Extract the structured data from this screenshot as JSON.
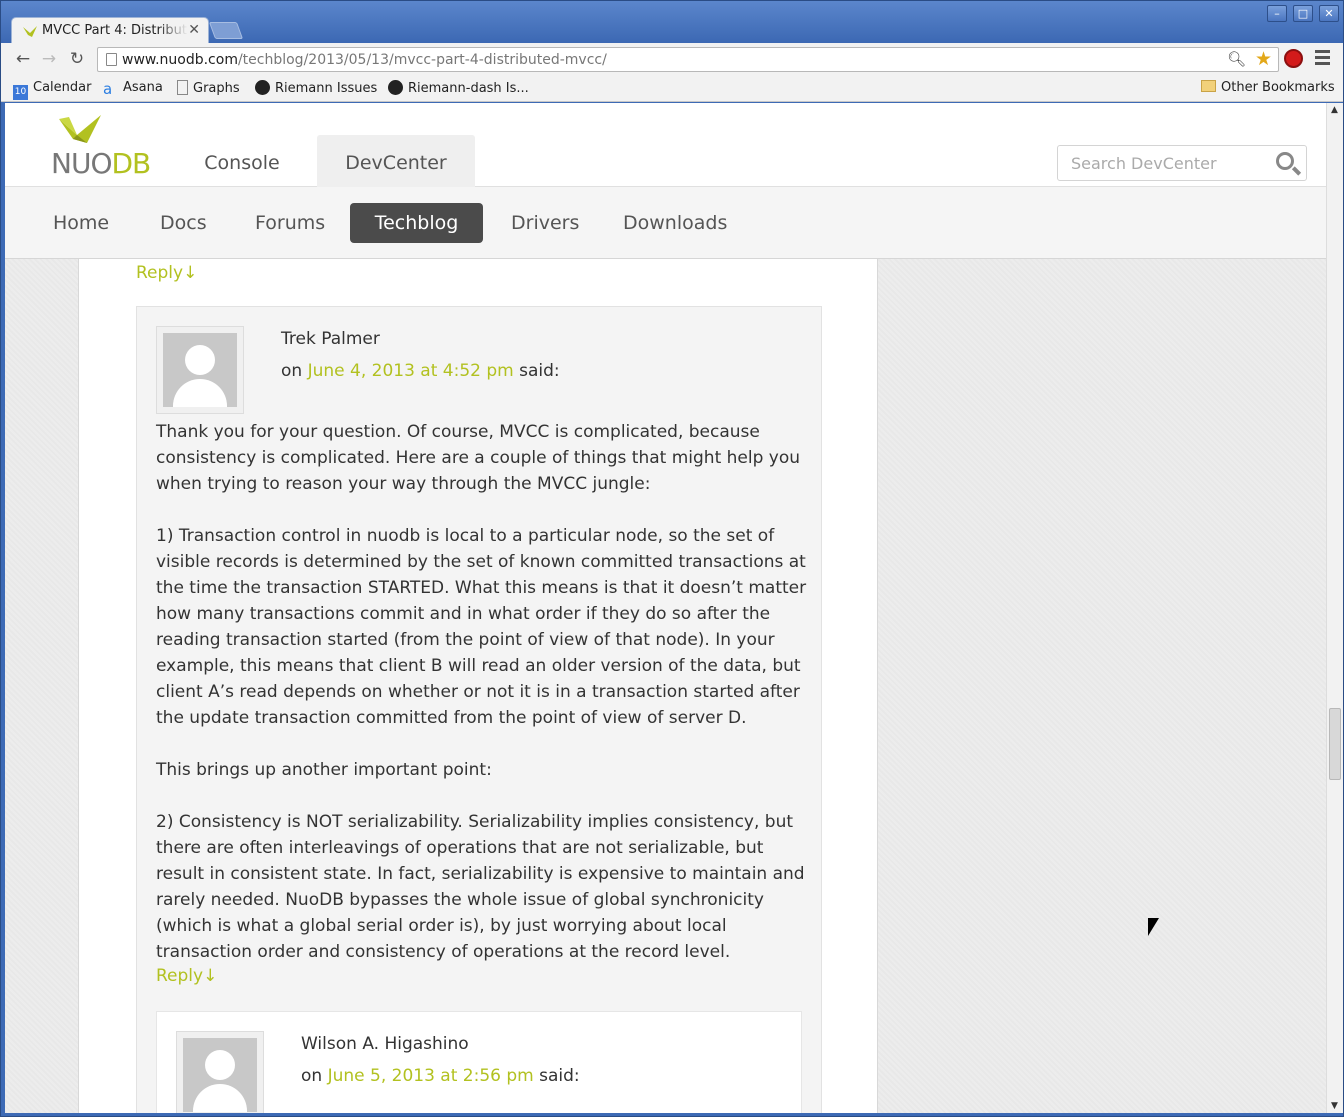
{
  "browser": {
    "tab_title": "MVCC Part 4: Distributed MVCC",
    "url_domain": "www.nuodb.com",
    "url_path": "/techblog/2013/05/13/mvcc-part-4-distributed-mvcc/",
    "bookmarks": [
      {
        "label": "Calendar",
        "icon": "calendar-icon"
      },
      {
        "label": "Asana",
        "icon": "asana-icon"
      },
      {
        "label": "Graphs",
        "icon": "page-icon"
      },
      {
        "label": "Riemann Issues",
        "icon": "github-icon"
      },
      {
        "label": "Riemann-dash Is...",
        "icon": "github-icon"
      }
    ],
    "other_bookmarks": "Other Bookmarks"
  },
  "site": {
    "logo_text_a": "NUO",
    "logo_text_b": "DB",
    "header_tabs": [
      "Console",
      "DevCenter"
    ],
    "active_header_tab": "DevCenter",
    "search_placeholder": "Search DevCenter",
    "subnav": [
      "Home",
      "Docs",
      "Forums",
      "Techblog",
      "Drivers",
      "Downloads"
    ],
    "active_subnav": "Techblog",
    "accent_color": "#b2c120"
  },
  "comments": {
    "top_reply": "Reply↓",
    "c1": {
      "author": "Trek Palmer",
      "prefix": "on",
      "date": "June 4, 2013 at 4:52 pm",
      "suffix": "said:",
      "paragraphs": [
        "Thank you for your question. Of course, MVCC is complicated, because consistency is complicated. Here are a couple of things that might help you when trying to reason your way through the MVCC jungle:",
        "1) Transaction control in nuodb is local to a particular node, so the set of visible records is determined by the set of known committed transactions at the time the transaction STARTED. What this means is that it doesn’t matter how many transactions commit and in what order if they do so after the reading transaction started (from the point of view of that node). In your example, this means that client B will read an older version of the data, but client A’s read depends on whether or not it is in a transaction started after the update transaction committed from the point of view of server D.",
        "This brings up another important point:",
        "2) Consistency is NOT serializability. Serializability implies consistency, but there are often interleavings of operations that are not serializable, but result in consistent state. In fact, serializability is expensive to maintain and rarely needed. NuoDB bypasses the whole issue of global synchronicity (which is what a global serial order is), by just worrying about local transaction order and consistency of operations at the record level."
      ],
      "reply": "Reply↓"
    },
    "c2": {
      "author": "Wilson A. Higashino",
      "prefix": "on",
      "date": "June 5, 2013 at 2:56 pm",
      "suffix": "said:"
    }
  }
}
